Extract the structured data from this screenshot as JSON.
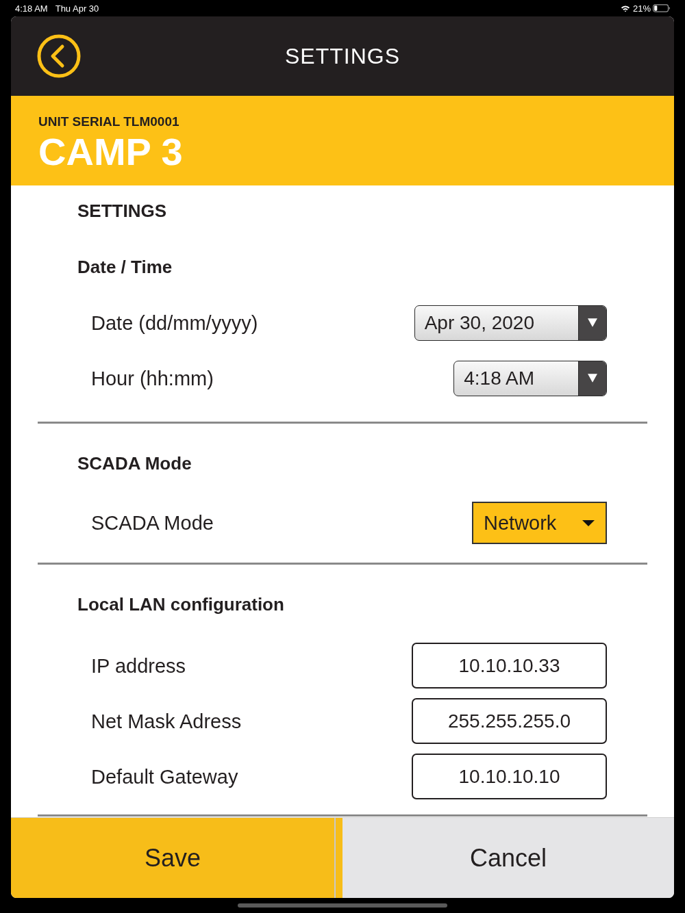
{
  "status_bar": {
    "time": "4:18 AM",
    "date": "Thu Apr 30",
    "battery": "21%"
  },
  "header": {
    "title": "SETTINGS"
  },
  "unit": {
    "serial": "UNIT SERIAL TLM0001",
    "name": "CAMP 3"
  },
  "page_title": "SETTINGS",
  "sections": [
    {
      "title": "Date / Time",
      "rows": [
        {
          "kind": "picker",
          "label": "Date (dd/mm/yyyy)",
          "value": "Apr 30, 2020"
        },
        {
          "kind": "picker",
          "label": "Hour (hh:mm)",
          "value": "4:18 AM"
        }
      ]
    },
    {
      "title": "SCADA Mode",
      "rows": [
        {
          "kind": "select",
          "label": "SCADA Mode",
          "value": "Network"
        }
      ]
    },
    {
      "title": "Local LAN configuration",
      "rows": [
        {
          "kind": "input",
          "label": "IP address",
          "value": "10.10.10.33"
        },
        {
          "kind": "input",
          "label": "Net Mask Adress",
          "value": "255.255.255.0"
        },
        {
          "kind": "input",
          "label": "Default Gateway",
          "value": "10.10.10.10"
        }
      ]
    }
  ],
  "buttons": [
    {
      "kind": "primary",
      "label": "Save"
    },
    {
      "kind": "secondary",
      "label": "Cancel"
    }
  ]
}
